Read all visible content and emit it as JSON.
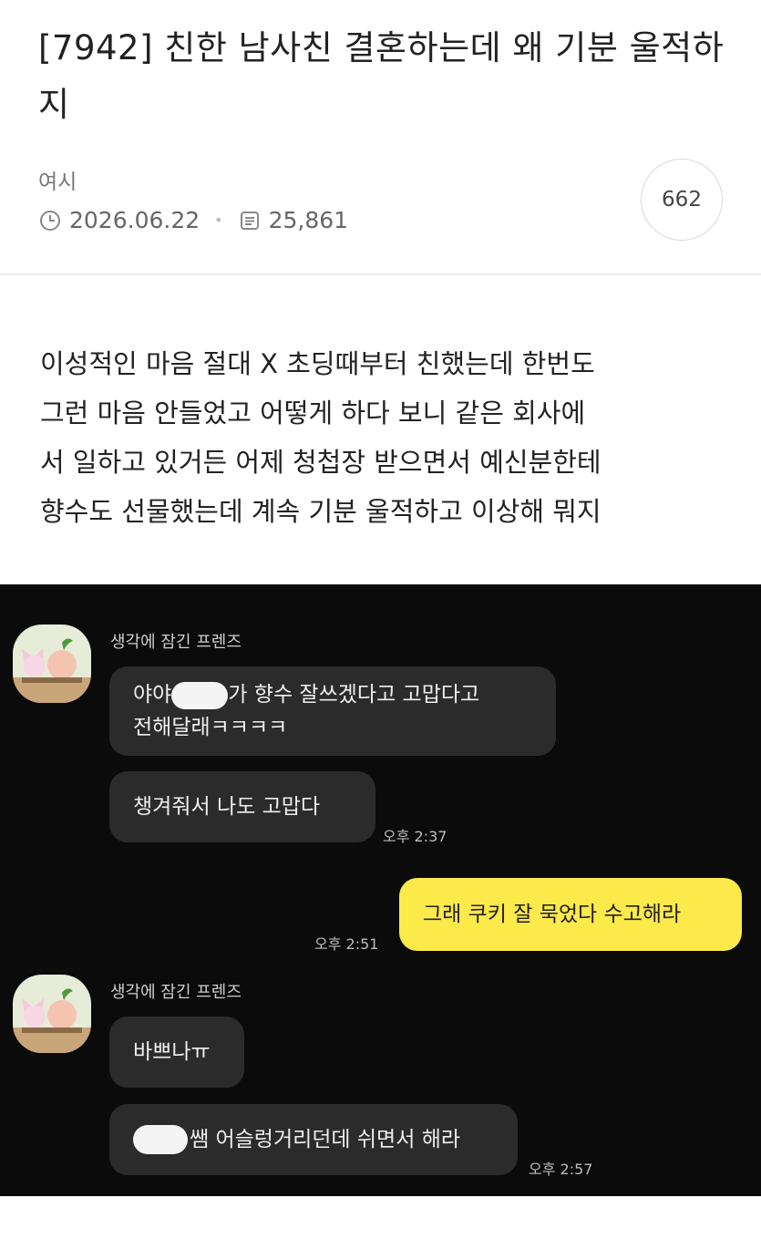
{
  "post": {
    "title": "[7942] 친한 남사친 결혼하는데 왜 기분 울적하지",
    "author": "여시",
    "date": "2026.06.22",
    "views": "25,861",
    "comment_count": "662"
  },
  "body_lines": [
    "이성적인 마음 절대 X 초딩때부터 친했는데 한번도",
    "그런 마음 안들었고 어떻게 하다 보니 같은 회사에",
    "서 일하고 있거든 어제 청첩장 받으면서 예신분한테",
    "향수도 선물했는데 계속 기분 울적하고 이상해 뭐지"
  ],
  "chat": {
    "sender_name": "생각에 잠긴 프렌즈",
    "messages": {
      "m1_prefix": "야야",
      "m1_suffix": "가 향수 잘쓰겠다고 고맙다고",
      "m1_line2": "전해달래ㅋㅋㅋㅋ",
      "m2": "챙겨줘서 나도 고맙다",
      "m2_time": "오후 2:37",
      "m3": "그래 쿠키 잘 묵었다 수고해라",
      "m3_time": "오후 2:51",
      "m4": "바쁘나ㅠ",
      "m5_suffix": "쌤 어슬렁거리던데 쉬면서 해라",
      "m5_time": "오후 2:57"
    }
  },
  "colors": {
    "chat_background": "#0b0b0b",
    "incoming_bubble": "#2b2b2b",
    "outgoing_bubble": "#fce94a",
    "avatar_background": "#e6ecd8"
  },
  "icons": [
    "clock-icon",
    "views-icon",
    "friends-avatar-icon"
  ]
}
